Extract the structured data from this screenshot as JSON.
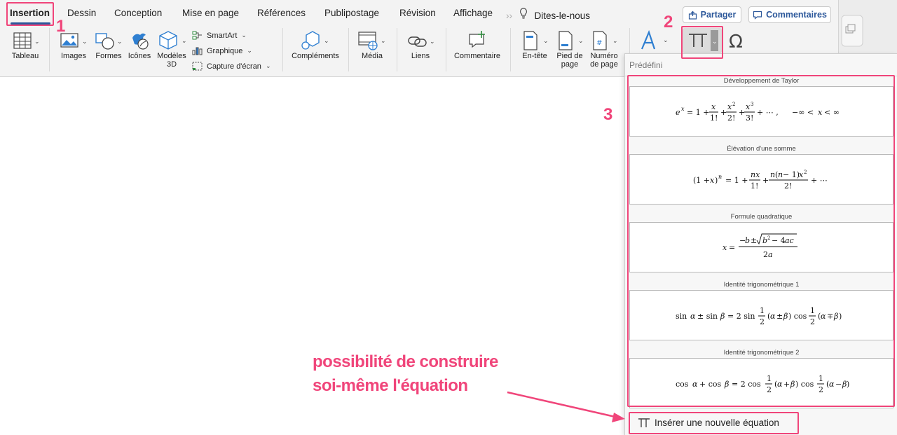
{
  "tabs": [
    "Insertion",
    "Dessin",
    "Conception",
    "Mise en page",
    "Références",
    "Publipostage",
    "Révision",
    "Affichage"
  ],
  "tell_me": "Dites-le-nous",
  "share_label": "Partager",
  "comments_label": "Commentaires",
  "ribbon": {
    "table": "Tableau",
    "images": "Images",
    "shapes": "Formes",
    "icons": "Icônes",
    "models_line1": "Modèles",
    "models_line2": "3D",
    "smartart": "SmartArt",
    "chart": "Graphique",
    "screenshot": "Capture d'écran",
    "addins": "Compléments",
    "media": "Média",
    "links": "Liens",
    "comment": "Commentaire",
    "header": "En-tête",
    "footer_line1": "Pied de",
    "footer_line2": "page",
    "pagenum_line1": "Numéro",
    "pagenum_line2": "de page"
  },
  "panel": {
    "heading": "Prédéfini",
    "equations": [
      {
        "title": "Développement de Taylor"
      },
      {
        "title": "Élévation d'une somme"
      },
      {
        "title": "Formule quadratique"
      },
      {
        "title": "Identité trigonométrique 1"
      },
      {
        "title": "Identité trigonométrique 2"
      }
    ],
    "insert_label": "Insérer une nouvelle équation"
  },
  "annotations": {
    "step1": "1",
    "step2": "2",
    "step3": "3",
    "text_line1": "possibilité de construire",
    "text_line2": "soi-même l'équation",
    "color": "#f0457a"
  },
  "colors": {
    "accent": "#2b579a"
  }
}
